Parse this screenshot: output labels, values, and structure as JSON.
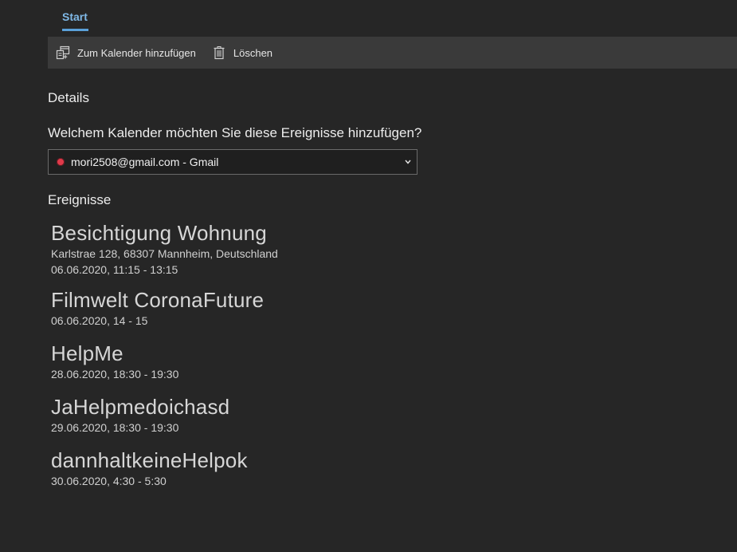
{
  "tabs": [
    {
      "label": "Start",
      "active": true
    }
  ],
  "toolbar": {
    "add_label": "Zum Kalender hinzufügen",
    "delete_label": "Löschen"
  },
  "details": {
    "title": "Details",
    "question": "Welchem Kalender möchten Sie diese Ereignisse hinzufügen?",
    "calendar_select": {
      "value": "mori2508@gmail.com - Gmail",
      "color": "#e03a4a"
    }
  },
  "events_section": {
    "title": "Ereignisse",
    "events": [
      {
        "title": "Besichtigung Wohnung",
        "location": "Karlstrae 128, 68307 Mannheim, Deutschland",
        "time": "06.06.2020, 11:15 - 13:15"
      },
      {
        "title": "Filmwelt CoronaFuture",
        "time": "06.06.2020, 14 - 15"
      },
      {
        "title": "HelpMe",
        "time": "28.06.2020, 18:30 - 19:30"
      },
      {
        "title": "JaHelpmedoichasd",
        "time": "29.06.2020, 18:30 - 19:30"
      },
      {
        "title": "dannhaltkeineHelpok",
        "time": "30.06.2020, 4:30 - 5:30"
      }
    ]
  },
  "colors": {
    "background": "#262626",
    "toolbar": "#3a3a3a",
    "accent": "#5aa0d8"
  }
}
